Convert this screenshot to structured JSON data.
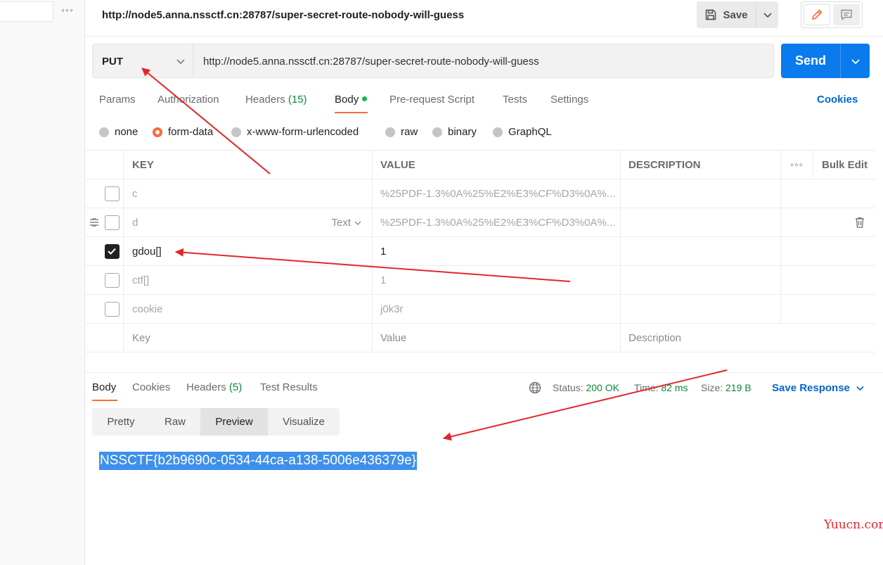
{
  "sidebar": {
    "more_icon": "more-horizontal-icon",
    "more_glyph": "◦◦◦"
  },
  "topbar": {
    "title": "http://node5.anna.nssctf.cn:28787/super-secret-route-nobody-will-guess",
    "save_label": "Save",
    "save_icon": "floppy-disk-icon"
  },
  "request": {
    "method": "PUT",
    "url": "http://node5.anna.nssctf.cn:28787/super-secret-route-nobody-will-guess",
    "send_label": "Send",
    "tabs": [
      {
        "label": "Params"
      },
      {
        "label": "Authorization"
      },
      {
        "label": "Headers",
        "count": "(15)"
      },
      {
        "label": "Body"
      },
      {
        "label": "Pre-request Script"
      },
      {
        "label": "Tests"
      },
      {
        "label": "Settings"
      }
    ],
    "cookies_label": "Cookies",
    "active_tab": "Body"
  },
  "body_modes": [
    "none",
    "form-data",
    "x-www-form-urlencoded",
    "raw",
    "binary",
    "GraphQL"
  ],
  "selected_body_mode": "form-data",
  "params_table": {
    "headers": {
      "key": "KEY",
      "value": "VALUE",
      "description": "DESCRIPTION",
      "more": "◦◦◦",
      "bulk_edit": "Bulk Edit"
    },
    "rows": [
      {
        "key": "c",
        "value": "%25PDF-1.3%0A%25%E2%E3%CF%D3%0A%...",
        "checked": false
      },
      {
        "key": "d",
        "value": "%25PDF-1.3%0A%25%E2%E3%CF%D3%0A%...",
        "checked": false,
        "type": "Text"
      },
      {
        "key": "gdou[]",
        "value": "1",
        "checked": true
      },
      {
        "key": "ctf[]",
        "value": "1",
        "checked": false
      },
      {
        "key": "cookie",
        "value": "j0k3r",
        "checked": false
      }
    ],
    "placeholders": {
      "key": "Key",
      "value": "Value",
      "description": "Description"
    }
  },
  "response": {
    "tabs": [
      {
        "label": "Body"
      },
      {
        "label": "Cookies"
      },
      {
        "label": "Headers",
        "count": "(5)"
      },
      {
        "label": "Test Results"
      }
    ],
    "status_label": "Status:",
    "status_value": "200 OK",
    "time_label": "Time:",
    "time_value": "82 ms",
    "size_label": "Size:",
    "size_value": "219 B",
    "save_response_label": "Save Response",
    "view_modes": [
      "Pretty",
      "Raw",
      "Preview",
      "Visualize"
    ],
    "active_view": "Preview",
    "body_text": "NSSCTF{b2b9690c-0534-44ca-a138-5006e436379e}"
  },
  "watermark": "Yuucn.com",
  "colors": {
    "accent": "#ff6c37",
    "send": "#097bed",
    "link": "#0265d2",
    "ok": "#0b8a33",
    "arrow": "#e4262a",
    "selection": "#3e90eb"
  }
}
